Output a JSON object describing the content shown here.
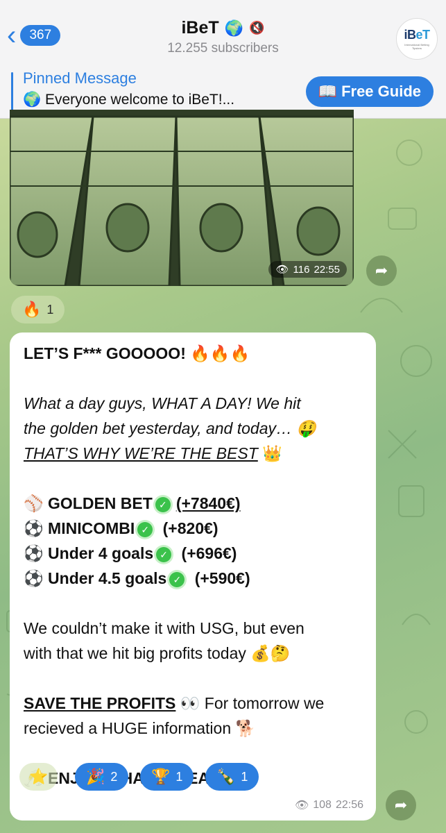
{
  "header": {
    "back_count": "367",
    "title": "iBeT",
    "subtitle": "12.255 subscribers",
    "logo_text_a": "iB",
    "logo_text_b": "eT",
    "logo_sub": "International Betting Tipsters"
  },
  "pinned": {
    "title": "Pinned Message",
    "text": "🌍 Everyone welcome to iBeT!...",
    "button": "📖 Free Guide"
  },
  "image_message": {
    "views": "116",
    "time": "22:55",
    "reaction_emoji": "🔥",
    "reaction_count": "1"
  },
  "text_message": {
    "headline": "LET’S F*** GOOOOO! 🔥🔥🔥",
    "intro_1": "What a day guys, WHAT A DAY! We hit",
    "intro_2": "the golden bet yesterday, and today… 🤑",
    "intro_3": "THAT’S WHY WE’RE THE BEST",
    "intro_3_emoji": "👑",
    "results": [
      {
        "emoji": "⚾",
        "label": "GOLDEN BET",
        "profit": "(+7840€)"
      },
      {
        "emoji": "⚽",
        "label": "MINICOMBI",
        "profit": "(+820€)"
      },
      {
        "emoji": "⚽",
        "label": "Under 4 goals",
        "profit": "(+696€)"
      },
      {
        "emoji": "⚽",
        "label": "Under 4.5 goals",
        "profit": "(+590€)"
      }
    ],
    "para2_1": "We couldn’t make it with USG, but even",
    "para2_2": "with that we hit big profits today 💰🤔",
    "save_title": "SAVE THE PROFITS",
    "save_rest": " 👀 For tomorrow we",
    "save_2": "recieved a HUGE information 🐕",
    "enjoy": "🥂 ENJOY WHAT WE EARN 🥂",
    "views": "108",
    "time": "22:56",
    "reactions": [
      {
        "emoji": "⭐",
        "count": ""
      },
      {
        "emoji": "🎉",
        "count": "2"
      },
      {
        "emoji": "🏆",
        "count": "1"
      },
      {
        "emoji": "🍾",
        "count": "1"
      }
    ]
  },
  "colors": {
    "accent": "#2d7fe0",
    "check": "#3bc24b"
  }
}
